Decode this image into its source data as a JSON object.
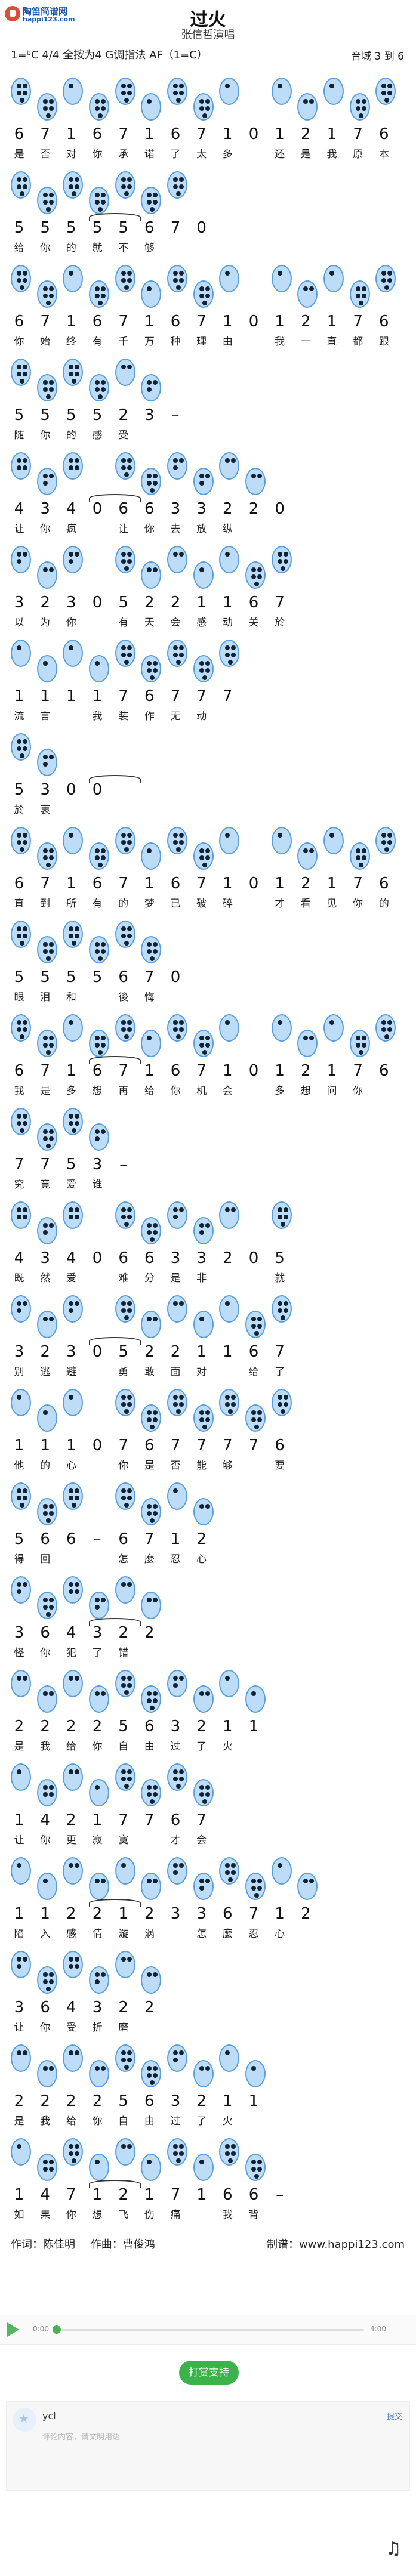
{
  "header": {
    "logo_text": "陶笛简谱网",
    "logo_url": "happi123.com",
    "title": "过火",
    "singer": "张信哲演唱",
    "meta": "1=ᵇC  4/4  全按为4  G调指法  AF（1=C）",
    "range": "音域 3 到 6"
  },
  "rows": [
    {
      "notes": [
        "6",
        "7",
        "1",
        "6",
        "7",
        "1",
        "6",
        "7",
        "1",
        "0",
        "1",
        "2",
        "1",
        "7",
        "6"
      ],
      "lyrics": [
        "是",
        "否",
        "对",
        "你",
        "承",
        "诺",
        "了",
        "太",
        "多",
        "",
        "还",
        "是",
        "我",
        "原",
        "本"
      ]
    },
    {
      "notes": [
        "5",
        "5",
        "5",
        "5",
        "5",
        "6",
        "7",
        "0"
      ],
      "lyrics": [
        "给",
        "你",
        "的",
        "就",
        "不",
        "够",
        "",
        ""
      ]
    },
    {
      "notes": [
        "6",
        "7",
        "1",
        "6",
        "7",
        "1",
        "6",
        "7",
        "1",
        "0",
        "1",
        "2",
        "1",
        "7",
        "6"
      ],
      "lyrics": [
        "你",
        "始",
        "终",
        "有",
        "千",
        "万",
        "种",
        "理",
        "由",
        "",
        "我",
        "一",
        "直",
        "都",
        "跟"
      ]
    },
    {
      "notes": [
        "5",
        "5",
        "5",
        "5",
        "2",
        "3",
        "–"
      ],
      "lyrics": [
        "随",
        "你",
        "的",
        "感",
        "受",
        "",
        ""
      ]
    },
    {
      "notes": [
        "4",
        "3",
        "4",
        "0",
        "6",
        "6",
        "3",
        "3",
        "2",
        "2",
        "0"
      ],
      "lyrics": [
        "让",
        "你",
        "疯",
        "",
        "让",
        "你",
        "去",
        "放",
        "纵",
        "",
        ""
      ]
    },
    {
      "notes": [
        "3",
        "2",
        "3",
        "0",
        "5",
        "2",
        "2",
        "1",
        "1",
        "6",
        "7"
      ],
      "lyrics": [
        "以",
        "为",
        "你",
        "",
        "有",
        "天",
        "会",
        "感",
        "动",
        "关",
        "於"
      ]
    },
    {
      "notes": [
        "1",
        "1",
        "1",
        "1",
        "7",
        "6",
        "7",
        "7",
        "7"
      ],
      "lyrics": [
        "流",
        "言",
        "",
        "我",
        "装",
        "作",
        "无",
        "动",
        ""
      ]
    },
    {
      "notes": [
        "5",
        "3",
        "0",
        "0"
      ],
      "lyrics": [
        "於",
        "衷",
        "",
        ""
      ]
    },
    {
      "notes": [
        "6",
        "7",
        "1",
        "6",
        "7",
        "1",
        "6",
        "7",
        "1",
        "0",
        "1",
        "2",
        "1",
        "7",
        "6"
      ],
      "lyrics": [
        "直",
        "到",
        "所",
        "有",
        "的",
        "梦",
        "已",
        "破",
        "碎",
        "",
        "才",
        "看",
        "见",
        "你",
        "的"
      ]
    },
    {
      "notes": [
        "5",
        "5",
        "5",
        "5",
        "6",
        "7",
        "0"
      ],
      "lyrics": [
        "眼",
        "泪",
        "和",
        "",
        "後",
        "悔",
        "",
        ""
      ]
    },
    {
      "notes": [
        "6",
        "7",
        "1",
        "6",
        "7",
        "1",
        "6",
        "7",
        "1",
        "0",
        "1",
        "2",
        "1",
        "7",
        "6"
      ],
      "lyrics": [
        "我",
        "是",
        "多",
        "想",
        "再",
        "给",
        "你",
        "机",
        "会",
        "",
        "多",
        "想",
        "问",
        "你"
      ]
    },
    {
      "notes": [
        "7",
        "7",
        "5",
        "3",
        "–"
      ],
      "lyrics": [
        "究",
        "竟",
        "爱",
        "谁",
        ""
      ]
    },
    {
      "notes": [
        "4",
        "3",
        "4",
        "0",
        "6",
        "6",
        "3",
        "3",
        "2",
        "0",
        "5"
      ],
      "lyrics": [
        "既",
        "然",
        "爱",
        "",
        "难",
        "分",
        "是",
        "非",
        "",
        "",
        "就"
      ]
    },
    {
      "notes": [
        "3",
        "2",
        "3",
        "0",
        "5",
        "2",
        "2",
        "1",
        "1",
        "6",
        "7"
      ],
      "lyrics": [
        "别",
        "逃",
        "避",
        "",
        "勇",
        "敢",
        "面",
        "对",
        "",
        "给",
        "了"
      ]
    },
    {
      "notes": [
        "1",
        "1",
        "1",
        "0",
        "7",
        "6",
        "7",
        "7",
        "7",
        "7",
        "6"
      ],
      "lyrics": [
        "他",
        "的",
        "心",
        "",
        "你",
        "是",
        "否",
        "能",
        "够",
        "",
        "要"
      ]
    },
    {
      "notes": [
        "5",
        "6",
        "6",
        "–",
        "6",
        "7",
        "1",
        "2"
      ],
      "lyrics": [
        "得",
        "回",
        "",
        "",
        "怎",
        "麼",
        "忍",
        "心"
      ]
    },
    {
      "notes": [
        "3",
        "6",
        "4",
        "3",
        "2",
        "2"
      ],
      "lyrics": [
        "怪",
        "你",
        "犯",
        "了",
        "错",
        ""
      ]
    },
    {
      "notes": [
        "2",
        "2",
        "2",
        "2",
        "5",
        "6",
        "3",
        "2",
        "1",
        "1"
      ],
      "lyrics": [
        "是",
        "我",
        "给",
        "你",
        "自",
        "由",
        "过",
        "了",
        "火",
        ""
      ]
    },
    {
      "notes": [
        "1",
        "4",
        "2",
        "1",
        "7",
        "7",
        "6",
        "7"
      ],
      "lyrics": [
        "让",
        "你",
        "更",
        "寂",
        "寞",
        "",
        "才",
        "会"
      ]
    },
    {
      "notes": [
        "1",
        "1",
        "2",
        "2",
        "1",
        "2",
        "3",
        "3",
        "6",
        "7",
        "1",
        "2"
      ],
      "lyrics": [
        "陷",
        "入",
        "感",
        "情",
        "漩",
        "涡",
        "",
        "怎",
        "麼",
        "忍",
        "心",
        ""
      ]
    },
    {
      "notes": [
        "3",
        "6",
        "4",
        "3",
        "2",
        "2"
      ],
      "lyrics": [
        "让",
        "你",
        "受",
        "折",
        "磨",
        ""
      ]
    },
    {
      "notes": [
        "2",
        "2",
        "2",
        "2",
        "5",
        "6",
        "3",
        "2",
        "1",
        "1"
      ],
      "lyrics": [
        "是",
        "我",
        "给",
        "你",
        "自",
        "由",
        "过",
        "了",
        "火",
        ""
      ]
    },
    {
      "notes": [
        "1",
        "4",
        "7",
        "1",
        "2",
        "1",
        "7",
        "1",
        "6",
        "6",
        "–"
      ],
      "lyrics": [
        "如",
        "果",
        "你",
        "想",
        "飞",
        "伤",
        "痛",
        "",
        "我",
        "背",
        ""
      ]
    }
  ],
  "credits": {
    "lyricist": "作词：陈佳明",
    "composer": "作曲：曹俊鸿",
    "producer": "制谱：www.happi123.com"
  },
  "player": {
    "start_time": "0:00",
    "end_time": "4:00",
    "progress": 0.0
  },
  "donate_label": "打赏支持",
  "comment": {
    "user": "ycl",
    "submit_label": "提交",
    "placeholder": "评论内容，请文明用语"
  },
  "colors": {
    "accent": "#3bb34a",
    "ocarina_fill": "#bcdcf7",
    "ocarina_stroke": "#5a9fdc"
  }
}
